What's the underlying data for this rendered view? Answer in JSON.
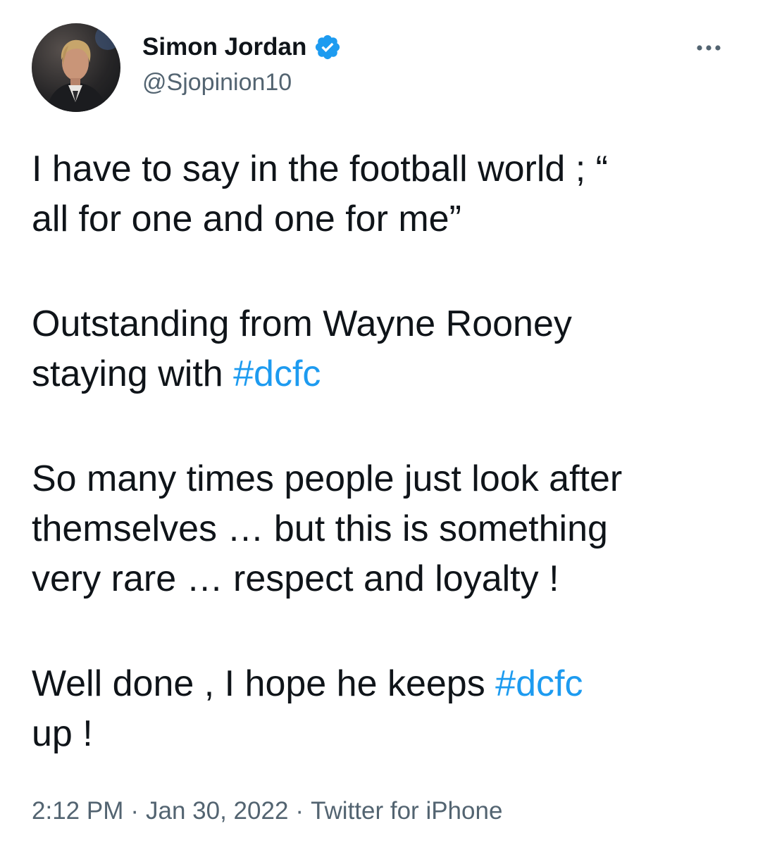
{
  "author": {
    "display_name": "Simon Jordan",
    "handle": "@Sjopinion10",
    "verified": true,
    "avatar_icon": "profile-photo"
  },
  "more_icon": "ellipsis-horizontal-icon",
  "tweet": {
    "paragraphs": [
      {
        "lines": [
          "I have to say in the football world ; “",
          "all for one and one for me”"
        ]
      },
      {
        "line1": "Outstanding from Wayne Rooney",
        "line2_text": "staying with ",
        "line2_hashtag": "#dcfc"
      },
      {
        "lines": [
          "So many times people just look after",
          "themselves … but this is something",
          "very rare … respect and loyalty !"
        ]
      },
      {
        "line1_text": "Well done , I hope he keeps ",
        "line1_hashtag": "#dcfc",
        "line2": "up !"
      }
    ]
  },
  "meta": {
    "time": "2:12 PM",
    "date": "Jan 30, 2022",
    "source": "Twitter for iPhone",
    "separator": "·"
  },
  "colors": {
    "text": "#0f1419",
    "secondary": "#536471",
    "link": "#1d9bf0",
    "verified": "#1d9bf0"
  }
}
